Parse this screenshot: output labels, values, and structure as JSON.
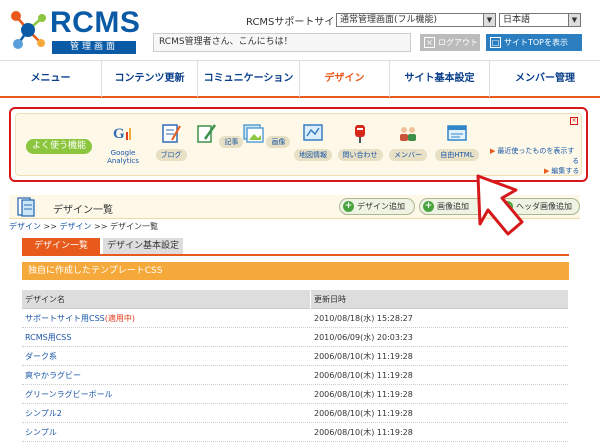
{
  "header": {
    "logo_text": "RCMS",
    "logo_sub": "管理画面",
    "site_label": "RCMSサポートサイト",
    "site_select": "通常管理画面(フル機能)",
    "lang_select": "日本語",
    "greeting": "RCMS管理者さん、こんにちは！",
    "logout": "ログアウト",
    "site_top": "サイトTOPを表示"
  },
  "nav": [
    {
      "label": "メニュー"
    },
    {
      "label": "コンテンツ更新"
    },
    {
      "label": "コミュニケーション"
    },
    {
      "label": "デザイン"
    },
    {
      "label": "サイト基本設定"
    },
    {
      "label": "メンバー管理"
    }
  ],
  "quick": {
    "badge": "よく使う機能",
    "items": [
      {
        "label_1": "Google",
        "label_2": "Analytics",
        "icon": "google-analytics-icon",
        "color": "#e53a1b"
      },
      {
        "label": "ブログ",
        "icon": "blog-icon",
        "color": "#2f6db5"
      },
      {
        "label": "記事",
        "icon": "article-icon",
        "color": "#3d8f4a"
      },
      {
        "label": "画像",
        "icon": "image-icon",
        "color": "#5a9fd4"
      },
      {
        "label": "地図情報",
        "icon": "map-icon",
        "color": "#3a7cc4"
      },
      {
        "label": "問い合わせ",
        "icon": "inquiry-icon",
        "color": "#d6281b"
      },
      {
        "label": "メンバー",
        "icon": "member-icon",
        "color": "#c8553a"
      },
      {
        "label": "自由HTML",
        "icon": "html-icon",
        "color": "#2f86c8"
      }
    ],
    "recent_1": "最近使ったものを表示す",
    "recent_2": "る",
    "edit": "編集する"
  },
  "section": {
    "title": "デザイン一覧",
    "buttons": [
      "デザイン追加",
      "画像追加",
      "ヘッダ画像追加"
    ]
  },
  "breadcrumb": {
    "home": "デザイン",
    "mid": "デザイン",
    "current": "デザイン一覧",
    "sep": ">>"
  },
  "tabs": [
    "デザイン一覧",
    "デザイン基本設定"
  ],
  "subhead": "独自に作成したテンプレートCSS",
  "table": {
    "headers": [
      "デザイン名",
      "更新日時"
    ],
    "rows": [
      {
        "name": "サポートサイト用CSS",
        "note": "(適用中)",
        "date": "2010/08/18(水) 15:28:27"
      },
      {
        "name": "RCMS用CSS",
        "date": "2010/06/09(水) 20:03:23"
      },
      {
        "name": "ダーク系",
        "date": "2006/08/10(木) 11:19:28"
      },
      {
        "name": "爽やかラグビー",
        "date": "2006/08/10(木) 11:19:28"
      },
      {
        "name": "グリーンラグビーボール",
        "date": "2006/08/10(木) 11:19:28"
      },
      {
        "name": "シンプル2",
        "date": "2006/08/10(木) 11:19:28"
      },
      {
        "name": "シンプル",
        "date": "2006/08/10(木) 11:19:28"
      }
    ]
  },
  "colors": {
    "brand": "#0a5aa5",
    "accent": "#e85a1b",
    "highlight": "#d6181b"
  }
}
